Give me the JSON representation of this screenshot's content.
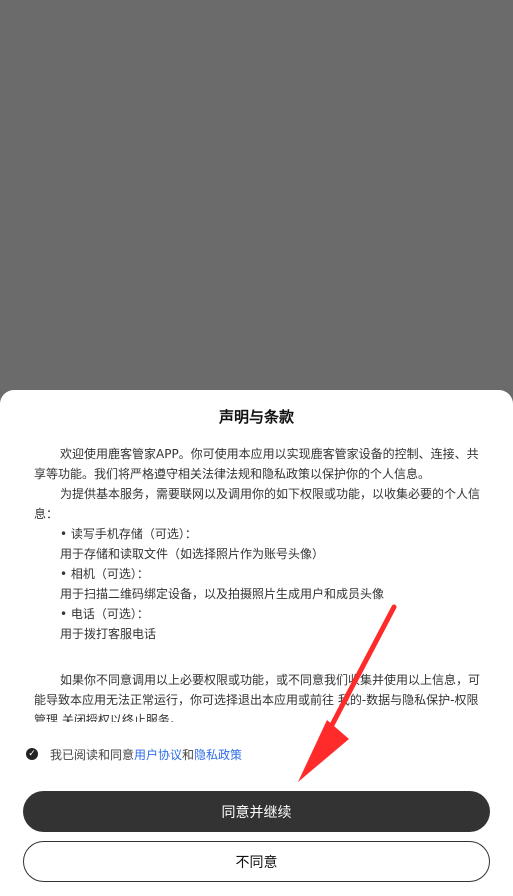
{
  "dialog": {
    "title": "声明与条款",
    "paragraph1": "欢迎使用鹿客管家APP。你可使用本应用以实现鹿客管家设备的控制、连接、共享等功能。我们将严格遵守相关法律法规和隐私政策以保护你的个人信息。",
    "paragraph2": "为提供基本服务，需要联网以及调用你的如下权限或功能，以收集必要的个人信息：",
    "permissions": [
      {
        "title": "• 读写手机存储（可选）：",
        "desc": "用于存储和读取文件（如选择照片作为账号头像）"
      },
      {
        "title": "• 相机（可选）：",
        "desc": "用于扫描二维码绑定设备，以及拍摄照片生成用户和成员头像"
      },
      {
        "title": "• 电话（可选）：",
        "desc": "用于拨打客服电话"
      }
    ],
    "paragraph3": "如果你不同意调用以上必要权限或功能，或不同意我们收集并使用以上信息，可能导致本应用无法正常运行，你可选择退出本应用或前往 我的-数据与隐私保护-权限管理 关闭授权以终止服务。"
  },
  "consent": {
    "prefix": "我已阅读和同意",
    "link1": "用户协议",
    "and": "和",
    "link2": "隐私政策"
  },
  "buttons": {
    "agree": "同意并继续",
    "disagree": "不同意"
  },
  "colors": {
    "overlay": "#6b6b6b",
    "link": "#2f6ee8",
    "primary_button": "#333333",
    "arrow": "#ff2a2a"
  }
}
